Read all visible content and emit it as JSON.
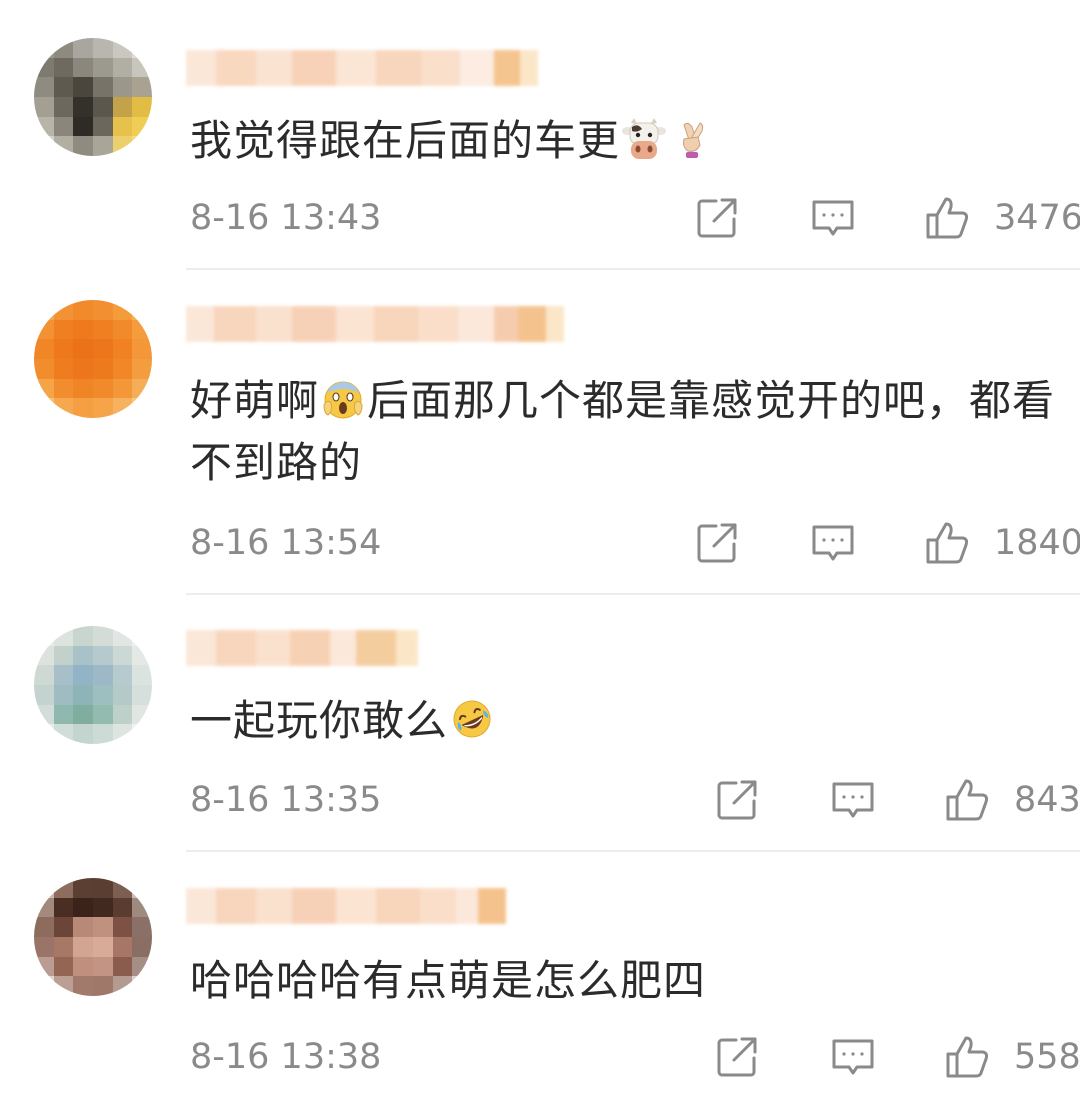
{
  "comments": [
    {
      "text": "我觉得跟在后面的车更",
      "time": "8-16 13:43",
      "likes": "3476",
      "emojis": [
        "cow-face-emoji",
        "crossed-fingers-emoji"
      ]
    },
    {
      "text_before": "好萌啊",
      "text_after": "后面那几个都是靠感觉开的吧，都看不到路的",
      "time": "8-16 13:54",
      "likes": "1840",
      "emojis": [
        "face-screaming-emoji"
      ]
    },
    {
      "text": "一起玩你敢么",
      "time": "8-16 13:35",
      "likes": "843",
      "emojis": [
        "rolling-laughing-emoji"
      ]
    },
    {
      "text": "哈哈哈哈有点萌是怎么肥四",
      "time": "8-16 13:38",
      "likes": "558",
      "emojis": []
    }
  ],
  "icons": {
    "share": "share-icon",
    "comment": "comment-icon",
    "like": "thumbs-up-icon"
  },
  "colors": {
    "text": "#2b2b2b",
    "meta": "#8a8a8a",
    "divider": "#ededed",
    "username_blur": "#f6c9a8"
  }
}
